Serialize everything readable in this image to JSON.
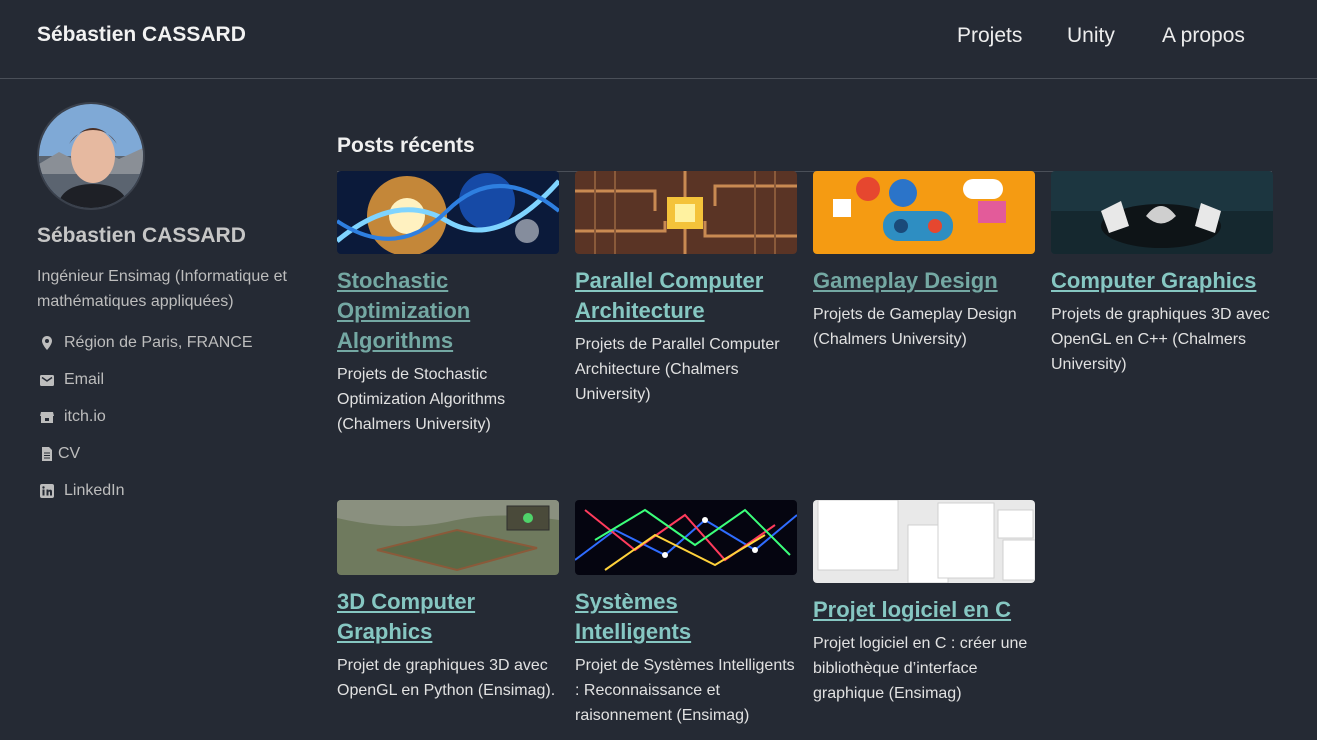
{
  "header": {
    "brand": "Sébastien CASSARD",
    "nav": [
      "Projets",
      "Unity",
      "A propos"
    ]
  },
  "sidebar": {
    "name": "Sébastien CASSARD",
    "bio": "Ingénieur Ensimag (Informatique et mathématiques appliquées)",
    "items": [
      {
        "label": "Région de Paris, FRANCE",
        "icon": "location-icon"
      },
      {
        "label": "Email",
        "icon": "email-icon"
      },
      {
        "label": "itch.io",
        "icon": "itchio-icon"
      },
      {
        "label": "CV",
        "icon": "document-icon"
      },
      {
        "label": "LinkedIn",
        "icon": "linkedin-icon"
      }
    ]
  },
  "posts": {
    "title": "Posts récents",
    "cards": [
      {
        "title": "Stochastic Optimization Algorithms",
        "desc": "Projets de Stochastic Optimization Algorithms (Chalmers University)"
      },
      {
        "title": "Parallel Computer Architecture",
        "desc": "Projets de Parallel Computer Architecture (Chalmers University)"
      },
      {
        "title": "Gameplay Design",
        "desc": "Projets de Gameplay Design (Chalmers University)"
      },
      {
        "title": "Computer Graphics",
        "desc": "Projets de graphiques 3D avec OpenGL en C++ (Chalmers University)"
      },
      {
        "title": "3D Computer Graphics",
        "desc": "Projet de graphiques 3D avec OpenGL en Python (Ensimag)."
      },
      {
        "title": "Systèmes Intelligents",
        "desc": "Projet de Systèmes Intelligents : Reconnaissance et raisonnement (Ensimag)"
      },
      {
        "title": "Projet logiciel en C",
        "desc": "Projet logiciel en C : créer une bibliothèque d’interface graphique (Ensimag)"
      }
    ]
  },
  "colors": {
    "background": "#252a34",
    "link": "#86c7c2",
    "link_visited": "#74a8a3"
  }
}
